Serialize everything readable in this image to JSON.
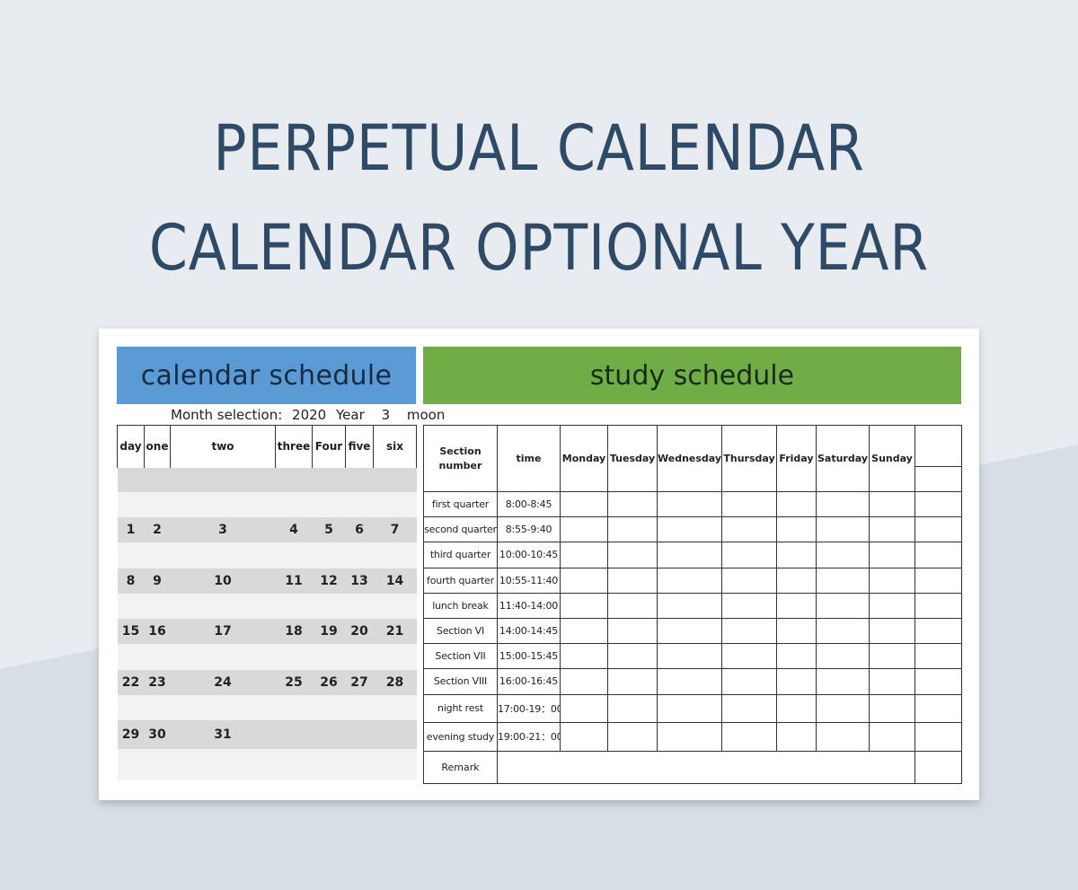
{
  "page": {
    "title_line1": "PERPETUAL CALENDAR",
    "title_line2": "CALENDAR OPTIONAL YEAR"
  },
  "calendar": {
    "banner": "calendar schedule",
    "banner_color": "#5b9bd5",
    "month_selection": {
      "label": "Month selection:",
      "year": "2020",
      "year_label": "Year",
      "month": "3",
      "month_label": "moon"
    },
    "headers": [
      "day",
      "one",
      "two",
      "three",
      "Four",
      "five",
      "six"
    ],
    "weeks": [
      [
        "",
        "",
        "",
        "",
        "",
        "",
        ""
      ],
      [
        "1",
        "2",
        "3",
        "4",
        "5",
        "6",
        "7"
      ],
      [
        "8",
        "9",
        "10",
        "11",
        "12",
        "13",
        "14"
      ],
      [
        "15",
        "16",
        "17",
        "18",
        "19",
        "20",
        "21"
      ],
      [
        "22",
        "23",
        "24",
        "25",
        "26",
        "27",
        "28"
      ],
      [
        "29",
        "30",
        "31",
        "",
        "",
        "",
        ""
      ]
    ]
  },
  "study": {
    "banner": "study schedule",
    "banner_color": "#70ad47",
    "headers": {
      "section": "Section number",
      "time": "time",
      "days": [
        "Monday",
        "Tuesday",
        "Wednesday",
        "Thursday",
        "Friday",
        "Saturday",
        "Sunday"
      ]
    },
    "rows": [
      {
        "section": "first quarter",
        "time": "8:00-8:45"
      },
      {
        "section": "second quarter",
        "time": "8:55-9:40"
      },
      {
        "section": "third quarter",
        "time": "10:00-10:45"
      },
      {
        "section": "fourth quarter",
        "time": "10:55-11:40"
      },
      {
        "section": "lunch break",
        "time": "11:40-14:00"
      },
      {
        "section": "Section VI",
        "time": "14:00-14:45"
      },
      {
        "section": "Section VII",
        "time": "15:00-15:45"
      },
      {
        "section": "Section VIII",
        "time": "16:00-16:45"
      },
      {
        "section": "night rest",
        "time": "17:00-19：00"
      },
      {
        "section": "evening study",
        "time": "19:00-21：00"
      }
    ],
    "remark_label": "Remark"
  }
}
